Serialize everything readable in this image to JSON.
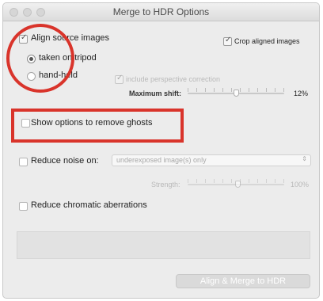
{
  "window": {
    "title": "Merge to HDR Options"
  },
  "align": {
    "label": "Align source images",
    "checked": true,
    "radio_tripod": "taken on tripod",
    "radio_handheld": "hand-held",
    "selected": "taken on tripod"
  },
  "crop": {
    "label": "Crop aligned images",
    "checked": true
  },
  "perspective": {
    "label": "include perspective correction",
    "checked": true,
    "enabled": false
  },
  "max_shift": {
    "label": "Maximum shift:",
    "value_text": "12%",
    "value": 0.5
  },
  "ghosts": {
    "label": "Show options to remove ghosts",
    "checked": false
  },
  "noise": {
    "label": "Reduce noise on:",
    "checked": false,
    "option": "underexposed image(s) only",
    "strength_label": "Strength:",
    "strength_value_text": "100%",
    "strength_value": 0.5
  },
  "chromatic": {
    "label": "Reduce chromatic aberrations",
    "checked": false
  },
  "merge_button": {
    "label": "Align & Merge to HDR"
  },
  "annotation_color": "#d9342b"
}
